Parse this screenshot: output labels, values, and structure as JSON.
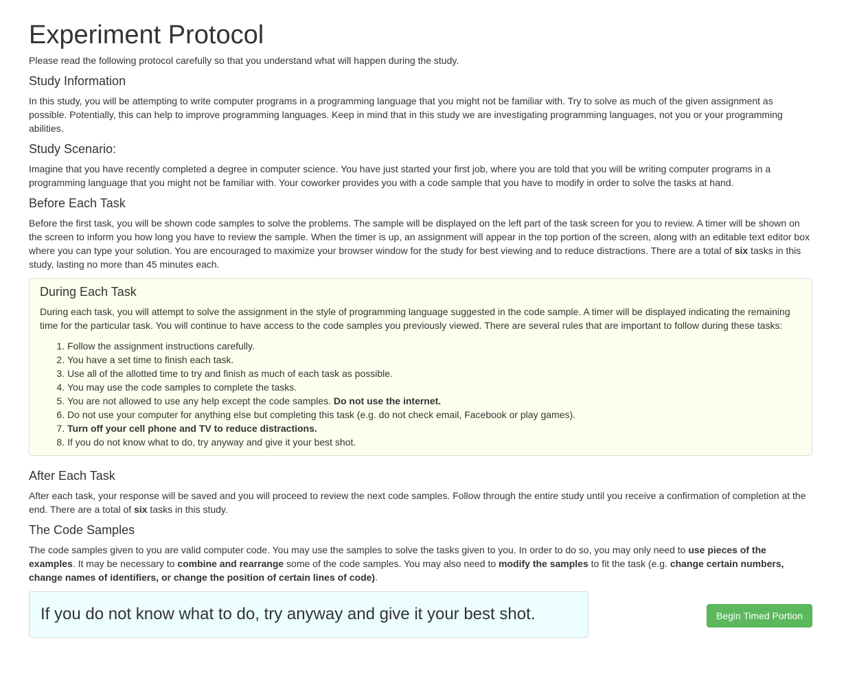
{
  "page": {
    "title": "Experiment Protocol",
    "intro": "Please read the following protocol carefully so that you understand what will happen during the study."
  },
  "study_information": {
    "heading": "Study Information",
    "text": "In this study, you will be attempting to write computer programs in a programming language that you might not be familiar with. Try to solve as much of the given assignment as possible. Potentially, this can help to improve programming languages. Keep in mind that in this study we are investigating programming languages, not you or your programming abilities."
  },
  "study_scenario": {
    "heading": "Study Scenario:",
    "text": "Imagine that you have recently completed a degree in computer science. You have just started your first job, where you are told that you will be writing computer programs in a programming language that you might not be familiar with. Your coworker provides you with a code sample that you have to modify in order to solve the tasks at hand."
  },
  "before_each_task": {
    "heading": "Before Each Task",
    "text_a": "Before the first task, you will be shown code samples to solve the problems. The sample will be displayed on the left part of the task screen for you to review. A timer will be shown on the screen to inform you how long you have to review the sample. When the timer is up, an assignment will appear in the top portion of the screen, along with an editable text editor box where you can type your solution. You are encouraged to maximize your browser window for the study for best viewing and to reduce distractions. There are a total of ",
    "text_bold": "six",
    "text_b": " tasks in this study, lasting no more than 45 minutes each."
  },
  "during_each_task": {
    "heading": "During Each Task",
    "text": "During each task, you will attempt to solve the assignment in the style of programming language suggested in the code sample. A timer will be displayed indicating the remaining time for the particular task. You will continue to have access to the code samples you previously viewed. There are several rules that are important to follow during these tasks:",
    "rule1": "Follow the assignment instructions carefully.",
    "rule2": "You have a set time to finish each task.",
    "rule3": "Use all of the allotted time to try and finish as much of each task as possible.",
    "rule4": "You may use the code samples to complete the tasks.",
    "rule5_a": "You are not allowed to use any help except the code samples. ",
    "rule5_bold": "Do not use the internet.",
    "rule6": "Do not use your computer for anything else but completing this task (e.g. do not check email, Facebook or play games).",
    "rule7_bold": "Turn off your cell phone and TV to reduce distractions.",
    "rule8": "If you do not know what to do, try anyway and give it your best shot."
  },
  "after_each_task": {
    "heading": "After Each Task",
    "text_a": "After each task, your response will be saved and you will proceed to review the next code samples. Follow through the entire study until you receive a confirmation of completion at the end. There are a total of ",
    "text_bold": "six",
    "text_b": " tasks in this study."
  },
  "code_samples": {
    "heading": "The Code Samples",
    "t1": "The code samples given to you are valid computer code. You may use the samples to solve the tasks given to you. In order to do so, you may only need to ",
    "b1": "use pieces of the examples",
    "t2": ". It may be necessary to ",
    "b2": "combine and rearrange",
    "t3": " some of the code samples. You may also need to ",
    "b3": "modify the samples",
    "t4": " to fit the task (e.g. ",
    "b4": "change certain numbers, change names of identifiers, or change the position of certain lines of code)",
    "t5": "."
  },
  "callout": {
    "text": "If you do not know what to do, try anyway and give it your best shot."
  },
  "actions": {
    "begin_label": "Begin Timed Portion",
    "begin_color": "#5cb85c"
  }
}
